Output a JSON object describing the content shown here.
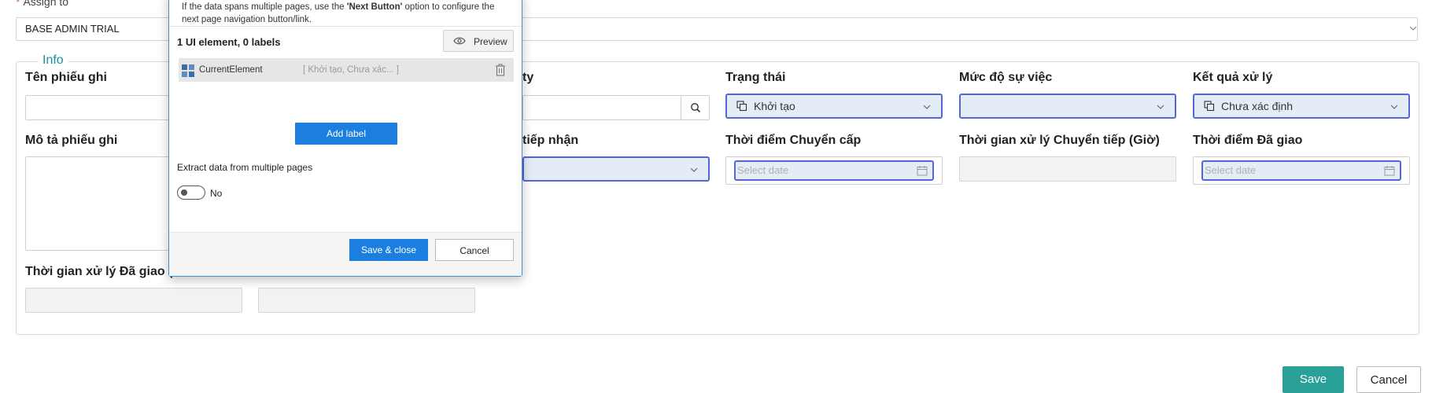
{
  "assign": {
    "label": "Assign to",
    "value": "BASE ADMIN TRIAL"
  },
  "info": {
    "legend": "Info",
    "fields": {
      "ten_phieu_ghi": "Tên phiếu ghi",
      "priority_suffix": "ty",
      "trang_thai": "Trạng thái",
      "trang_thai_value": "Khởi tạo",
      "muc_do": "Mức độ sự việc",
      "ket_qua": "Kết quả xử lý",
      "ket_qua_value": "Chưa xác định",
      "mo_ta": "Mô tả phiếu ghi",
      "tiep_nhan_suffix": "tiếp nhận",
      "thoi_diem_chuyen_cap": "Thời điểm Chuyển cấp",
      "thoi_gian_chuyen_tiep": "Thời gian xử lý Chuyển tiếp (Giờ)",
      "thoi_diem_da_giao": "Thời điểm Đã giao",
      "thoi_gian_da_giao": "Thời gian xử lý Đã giao (G",
      "date_placeholder": "Select date"
    }
  },
  "footer": {
    "save": "Save",
    "cancel": "Cancel"
  },
  "dialog": {
    "hint_pre": "If the data spans multiple pages, use the ",
    "hint_bold": "'Next Button'",
    "hint_post": " option to configure the next page navigation button/link.",
    "count": "1 UI element, 0 labels",
    "preview": "Preview",
    "element_name": "CurrentElement",
    "element_values": "[ Khởi tạo, Chưa xác...   ]",
    "add_label": "Add label",
    "extract": "Extract data from multiple pages",
    "toggle_label": "No",
    "save_close": "Save & close",
    "cancel": "Cancel"
  },
  "colors": {
    "accent_teal": "#2aa198",
    "primary_blue": "#1c7fe0",
    "highlight_border": "#5566dd"
  }
}
